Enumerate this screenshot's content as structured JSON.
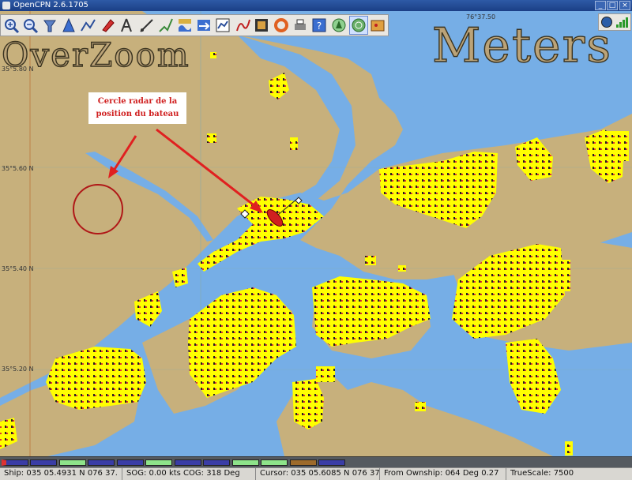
{
  "window": {
    "title": "OpenCPN 2.6.1705",
    "buttons": [
      "_",
      "□",
      "×"
    ]
  },
  "toolbar": {
    "tools": [
      {
        "name": "zoom-in-icon",
        "tooltip": "Zoom In"
      },
      {
        "name": "zoom-out-icon",
        "tooltip": "Zoom Out"
      },
      {
        "name": "shift-up-icon",
        "tooltip": "Shift to Larger Scale Chart"
      },
      {
        "name": "follow-ship-icon",
        "tooltip": "Auto Follow"
      },
      {
        "name": "route-icon",
        "tooltip": "Create Route"
      },
      {
        "name": "settings-icon",
        "tooltip": "ToolBox"
      },
      {
        "name": "text-icon",
        "tooltip": "Show ENC Text"
      },
      {
        "name": "measure-icon",
        "tooltip": "Measure Distance"
      },
      {
        "name": "mark-icon",
        "tooltip": "Drop Mark"
      },
      {
        "name": "tide-icon",
        "tooltip": "Show Tides"
      },
      {
        "name": "current-icon",
        "tooltip": "Show Currents"
      },
      {
        "name": "route-manager-icon",
        "tooltip": "Route Manager"
      },
      {
        "name": "track-icon",
        "tooltip": "Enable Tracking"
      },
      {
        "name": "color-scheme-icon",
        "tooltip": "Change Color Scheme"
      },
      {
        "name": "mob-icon",
        "tooltip": "Man Overboard"
      },
      {
        "name": "print-icon",
        "tooltip": "Print Chart"
      },
      {
        "name": "help-icon",
        "tooltip": "About OpenCPN"
      },
      {
        "name": "ais-icon",
        "tooltip": "Show AIS Targets"
      },
      {
        "name": "radar-icon",
        "tooltip": "Radar"
      },
      {
        "name": "plugin-icon",
        "tooltip": "Plugin"
      }
    ],
    "active_index": 18
  },
  "overlay": {
    "overzoom": "OverZoom",
    "units": "Meters"
  },
  "grid": {
    "lat_labels": [
      {
        "text": "35°5.80 N",
        "row": 0
      },
      {
        "text": "35°5.60 N",
        "row": 1
      },
      {
        "text": "35°5.40 N",
        "row": 2
      },
      {
        "text": "35°5.20 N",
        "row": 3
      }
    ],
    "lon_label": "76°37.50"
  },
  "annotation": {
    "line1": "Cercle radar de la",
    "line2": "position du bateau"
  },
  "piano": {
    "keys": [
      "red",
      "blue",
      "green",
      "blue",
      "blue",
      "green",
      "blue",
      "blue",
      "green",
      "green",
      "brown",
      "blue"
    ]
  },
  "status": {
    "ship": "Ship: 035 05.4931 N   076 37.",
    "sog": "SOG:  0.00 kts  COG:    318 Deg",
    "cursor": "Cursor: 035 05.6085 N 076 37.",
    "ownship": "From Ownship: 064 Deg     0.27",
    "scale": "TrueScale:        7500"
  },
  "colors": {
    "land": "#c7b07c",
    "water": "#76aee6",
    "radar_echo": "#ffff00",
    "annotation": "#d02020"
  }
}
